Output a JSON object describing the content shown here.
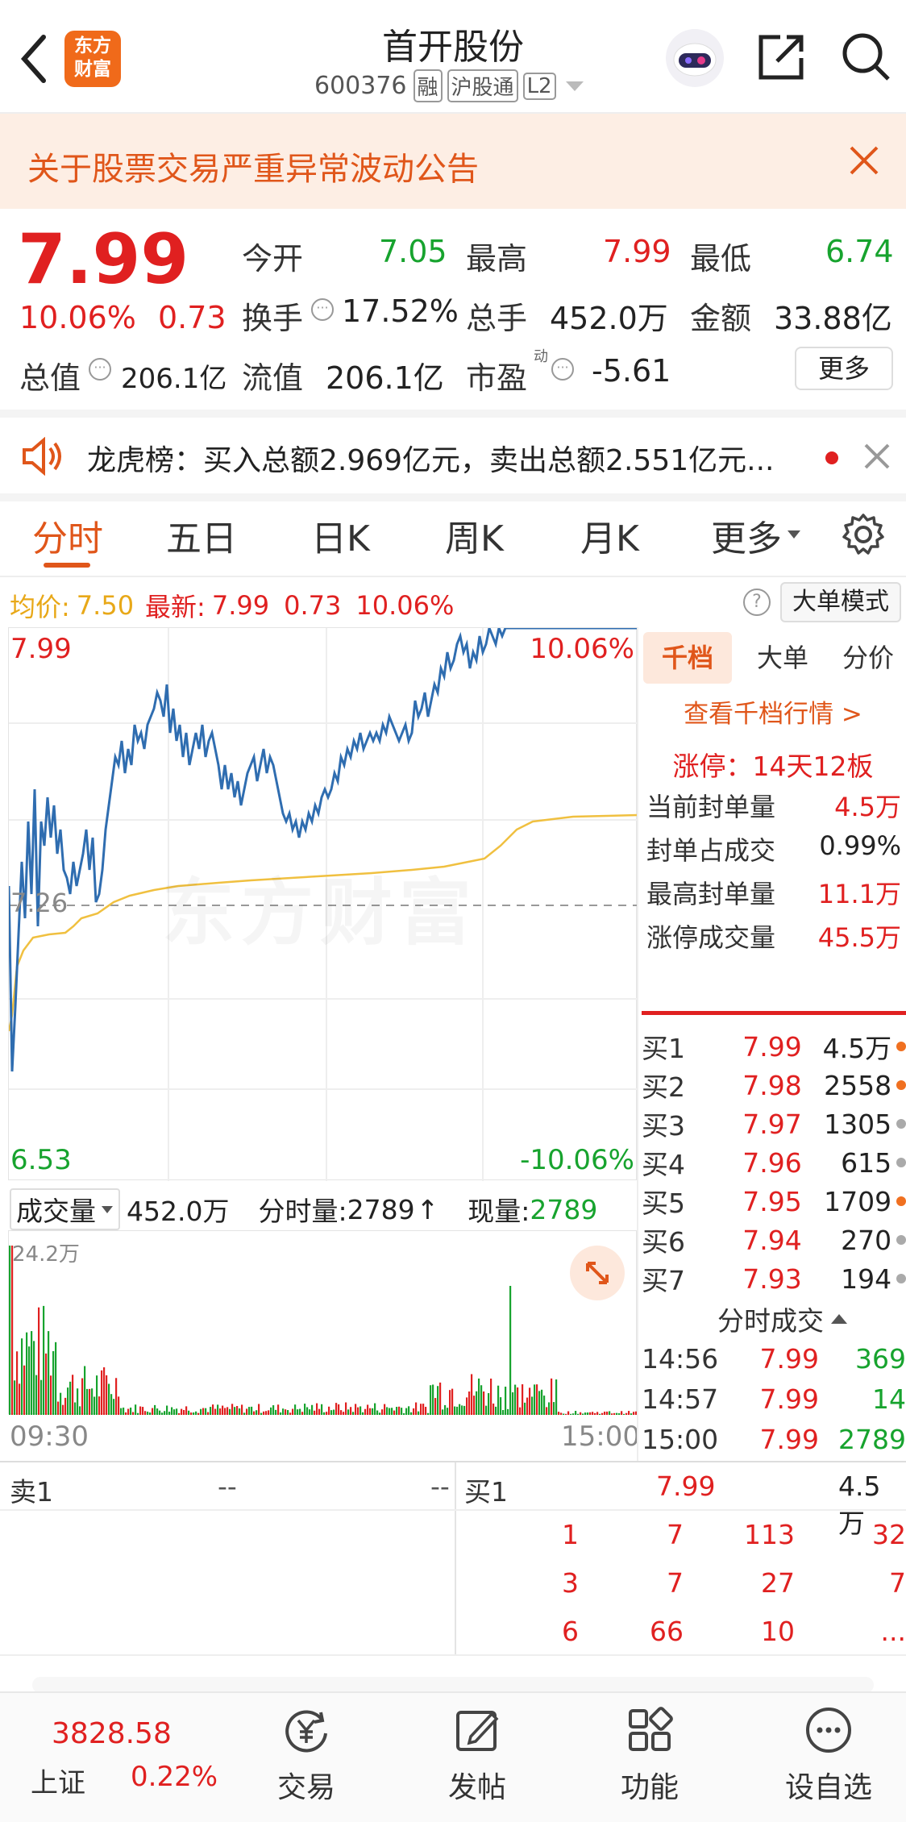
{
  "header": {
    "back_icon": "chevron-left-icon",
    "logo_text_1": "东方",
    "logo_text_2": "财富",
    "title": "首开股份",
    "code": "600376",
    "tag_rong": "融",
    "tag_hgt": "沪股通",
    "tag_l2": "L2"
  },
  "notice": {
    "text": "关于股票交易严重异常波动公告"
  },
  "quote": {
    "price": "7.99",
    "pct": "10.06%",
    "change": "0.73",
    "open_label": "今开",
    "open": "7.05",
    "high_label": "最高",
    "high": "7.99",
    "low_label": "最低",
    "low": "6.74",
    "turnover_label": "换手",
    "turnover": "17.52%",
    "volume_label": "总手",
    "volume": "452.0万",
    "amount_label": "金额",
    "amount": "33.88亿",
    "mktcap_label": "总值",
    "mktcap": "206.1亿",
    "float_label": "流值",
    "float": "206.1亿",
    "pe_label": "市盈",
    "pe_sup": "动",
    "pe": "-5.61",
    "more_button": "更多"
  },
  "dragon": {
    "text": "龙虎榜：买入总额2.969亿元，卖出总额2.551亿元..."
  },
  "tabs": [
    "分时",
    "五日",
    "日K",
    "周K",
    "月K",
    "更多"
  ],
  "chart_header": {
    "avg_label": "均价:",
    "avg": "7.50",
    "latest_label": "最新:",
    "latest": "7.99",
    "latest_change": "0.73",
    "latest_pct": "10.06%",
    "mode_button": "大单模式"
  },
  "chart_labels": {
    "top_price": "7.99",
    "top_pct": "10.06%",
    "mid_price": "7.26",
    "bottom_price": "6.53",
    "bottom_pct": "-10.06%",
    "watermark": "东方财富"
  },
  "volume_header": {
    "dropdown": "成交量",
    "total": "452.0万",
    "tick_label": "分时量:",
    "tick": "2789",
    "now_label": "现量:",
    "now": "2789",
    "max": "24.2万",
    "time_start": "09:30",
    "time_end": "15:00"
  },
  "side_tabs": [
    "千档",
    "大单",
    "分价"
  ],
  "side": {
    "view_link": "查看千档行情 >",
    "limit_title": "涨停：14天12板",
    "stats": [
      {
        "label": "当前封单量",
        "value": "4.5万"
      },
      {
        "label": "封单占成交",
        "value": "0.99%"
      },
      {
        "label": "最高封单量",
        "value": "11.1万"
      },
      {
        "label": "涨停成交量",
        "value": "45.5万"
      }
    ],
    "bids": [
      {
        "label": "买1",
        "price": "7.99",
        "vol": "4.5万",
        "dot": "#f07020"
      },
      {
        "label": "买2",
        "price": "7.98",
        "vol": "2558",
        "dot": "#f07020"
      },
      {
        "label": "买3",
        "price": "7.97",
        "vol": "1305",
        "dot": "#aaaaaa"
      },
      {
        "label": "买4",
        "price": "7.96",
        "vol": "615",
        "dot": "#aaaaaa"
      },
      {
        "label": "买5",
        "price": "7.95",
        "vol": "1709",
        "dot": "#f07020"
      },
      {
        "label": "买6",
        "price": "7.94",
        "vol": "270",
        "dot": "#aaaaaa"
      },
      {
        "label": "买7",
        "price": "7.93",
        "vol": "194",
        "dot": "#aaaaaa"
      }
    ],
    "ticks_title": "分时成交",
    "ticks": [
      {
        "time": "14:56",
        "price": "7.99",
        "vol": "369"
      },
      {
        "time": "14:57",
        "price": "7.99",
        "vol": "14"
      },
      {
        "time": "15:00",
        "price": "7.99",
        "vol": "2789"
      }
    ]
  },
  "orderbook": {
    "sell_label": "卖1",
    "sell_price": "--",
    "sell_vol": "--",
    "buy_label": "买1",
    "buy_price": "7.99",
    "buy_vol": "4.5万",
    "queue": [
      [
        "1",
        "7",
        "113",
        "32"
      ],
      [
        "3",
        "7",
        "27",
        "7"
      ],
      [
        "6",
        "66",
        "10",
        "..."
      ]
    ]
  },
  "bottom_nav": {
    "index_value": "3828.58",
    "index_name": "上证",
    "index_pct": "0.22%",
    "items": [
      {
        "label": "交易",
        "icon": "yen-cycle-icon"
      },
      {
        "label": "发帖",
        "icon": "edit-icon"
      },
      {
        "label": "功能",
        "icon": "grid-icon"
      },
      {
        "label": "设自选",
        "icon": "more-circle-icon"
      }
    ]
  },
  "colors": {
    "up": "#e02020",
    "down": "#17a32e",
    "brand": "#f06a1a",
    "price_line": "#2f6db0",
    "avg_line": "#f0c040"
  }
}
